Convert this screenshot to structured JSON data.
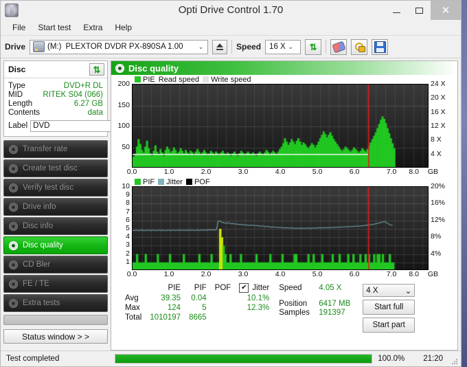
{
  "window": {
    "title": "Opti Drive Control 1.70",
    "app_icon": "disc-app-icon",
    "minimize": "–",
    "maximize": "□",
    "close": "✕"
  },
  "menu": {
    "items": [
      {
        "label": "File"
      },
      {
        "label": "Start test"
      },
      {
        "label": "Extra"
      },
      {
        "label": "Help"
      }
    ]
  },
  "toolbar": {
    "drive_label": "Drive",
    "drive_letter": "(M:)",
    "drive_name": "PLEXTOR DVDR   PX-890SA 1.00",
    "combo_arrow": "⌄",
    "eject_title": "Eject",
    "speed_label": "Speed",
    "speed_value": "16 X",
    "speed_arrow": "⌄",
    "refresh_icon": "⇅",
    "icons": [
      "refresh-icon",
      "eraser-icon",
      "plug-icon",
      "save-icon"
    ]
  },
  "disc": {
    "title": "Disc",
    "refresh_icon": "⇅",
    "rows": [
      {
        "key": "Type",
        "value": "DVD+R DL"
      },
      {
        "key": "MID",
        "value": "RITEK S04 (066)"
      },
      {
        "key": "Length",
        "value": "6.27 GB"
      },
      {
        "key": "Contents",
        "value": "data"
      }
    ],
    "label_key": "Label",
    "label_value": "DVD",
    "label_placeholder": "DVD"
  },
  "nav": {
    "items": [
      {
        "label": "Transfer rate",
        "active": false
      },
      {
        "label": "Create test disc",
        "active": false
      },
      {
        "label": "Verify test disc",
        "active": false
      },
      {
        "label": "Drive info",
        "active": false
      },
      {
        "label": "Disc info",
        "active": false
      },
      {
        "label": "Disc quality",
        "active": true
      },
      {
        "label": "CD Bler",
        "active": false
      },
      {
        "label": "FE / TE",
        "active": false
      },
      {
        "label": "Extra tests",
        "active": false
      }
    ],
    "status_window_button": "Status window > >"
  },
  "panel": {
    "header_title": "Disc quality",
    "header_icon": "disc-quality-icon"
  },
  "chart_data": [
    {
      "type": "area",
      "name": "pie-chart",
      "title": "PIE / Read speed",
      "xlabel": "GB",
      "ylabel": "PIE",
      "legend": [
        {
          "label": "PIE",
          "color": "#22c722"
        },
        {
          "label": "Read speed",
          "color": "#ffffff"
        },
        {
          "label": "Write speed",
          "color": "#d8d8d8"
        }
      ],
      "legend_position": "top-left",
      "grid": true,
      "xlim": [
        0.0,
        8.0
      ],
      "xticks": [
        "0.0",
        "1.0",
        "2.0",
        "3.0",
        "4.0",
        "5.0",
        "6.0",
        "7.0",
        "8.0"
      ],
      "x_unit": "GB",
      "ylim": [
        0,
        200
      ],
      "yticks": [
        "200",
        "150",
        "100",
        "50"
      ],
      "y2label": "Speed",
      "y2lim": [
        0,
        24
      ],
      "y2ticks": [
        "24 X",
        "20 X",
        "16 X",
        "12 X",
        "8 X",
        "4 X"
      ],
      "data_end_gb": 6.3,
      "marker_gb": 6.3,
      "marker_color": "#e01b1b",
      "read_speed_value": 4.05,
      "series": [
        {
          "name": "PIE",
          "color": "#22c722",
          "values": [
            28,
            35,
            52,
            70,
            58,
            44,
            38,
            52,
            66,
            48,
            36,
            30,
            42,
            55,
            40,
            34,
            46,
            38,
            30,
            44,
            52,
            46,
            38,
            42,
            50,
            44,
            36,
            40,
            48,
            42,
            36,
            44,
            38,
            34,
            42,
            38,
            32,
            40,
            46,
            40,
            34,
            38,
            44,
            38,
            32,
            36,
            42,
            38,
            34,
            40,
            36,
            32,
            38,
            42,
            36,
            32,
            38,
            34,
            30,
            36,
            40,
            34,
            30,
            36,
            42,
            38,
            32,
            36,
            40,
            36,
            32,
            38,
            34,
            30,
            36,
            40,
            36,
            32,
            38,
            44,
            40,
            34,
            38,
            42,
            38,
            34,
            40,
            46,
            52,
            60,
            72,
            64,
            56,
            62,
            70,
            64,
            58,
            66,
            72,
            64,
            56,
            62,
            58,
            52,
            48,
            54,
            60,
            56,
            50,
            56,
            64,
            72,
            80,
            88,
            82,
            74,
            80,
            86,
            78,
            70,
            64,
            58,
            52,
            46,
            42,
            46,
            52,
            48,
            44,
            40,
            44,
            50,
            46,
            42,
            38,
            42,
            48,
            44,
            40,
            46,
            54,
            62,
            70,
            78,
            86,
            96,
            106,
            116,
            124,
            118,
            108,
            96,
            84,
            72,
            60,
            48,
            0,
            0,
            0,
            0,
            0,
            0,
            0,
            0,
            0,
            0,
            0,
            0,
            0,
            0,
            0,
            0,
            0,
            0,
            0,
            0,
            0,
            0
          ]
        },
        {
          "name": "Read speed",
          "color": "#ffffff",
          "values_x": [
            4.05,
            4.05
          ]
        }
      ]
    },
    {
      "type": "bar",
      "name": "pif-chart",
      "title": "PIF / Jitter / POF",
      "xlabel": "GB",
      "ylabel": "PIF",
      "legend": [
        {
          "label": "PIF",
          "color": "#22c722"
        },
        {
          "label": "Jitter",
          "color": "#7fb3bd"
        },
        {
          "label": "POF",
          "color": "#000000"
        }
      ],
      "legend_position": "top-left",
      "grid": true,
      "xlim": [
        0.0,
        8.0
      ],
      "xticks": [
        "0.0",
        "1.0",
        "2.0",
        "3.0",
        "4.0",
        "5.0",
        "6.0",
        "7.0",
        "8.0"
      ],
      "x_unit": "GB",
      "ylim": [
        0,
        10
      ],
      "yticks": [
        "10",
        "9",
        "8",
        "7",
        "6",
        "5",
        "4",
        "3",
        "2",
        "1"
      ],
      "y2label": "Jitter",
      "y2lim": [
        0,
        20
      ],
      "y2ticks": [
        "20%",
        "16%",
        "12%",
        "8%",
        "4%"
      ],
      "data_end_gb": 6.3,
      "marker_gb": 6.3,
      "marker_color": "#e01b1b",
      "series": [
        {
          "name": "PIF",
          "color": "#22c722",
          "values": [
            1,
            1,
            2,
            1,
            1,
            1,
            1,
            2,
            1,
            1,
            1,
            1,
            1,
            1,
            2,
            1,
            1,
            1,
            1,
            1,
            1,
            2,
            1,
            1,
            1,
            1,
            1,
            1,
            1,
            2,
            1,
            1,
            1,
            1,
            1,
            1,
            1,
            1,
            2,
            1,
            1,
            1,
            1,
            1,
            1,
            2,
            1,
            1,
            1,
            1,
            5,
            4,
            3,
            2,
            1,
            1,
            2,
            1,
            1,
            1,
            1,
            1,
            2,
            1,
            1,
            1,
            1,
            1,
            1,
            1,
            1,
            2,
            1,
            1,
            1,
            1,
            1,
            1,
            1,
            2,
            1,
            1,
            1,
            1,
            1,
            1,
            2,
            1,
            1,
            1,
            1,
            1,
            1,
            2,
            2,
            1,
            1,
            1,
            1,
            1,
            1,
            2,
            1,
            1,
            2,
            1,
            1,
            1,
            1,
            2,
            1,
            1,
            1,
            1,
            1,
            2,
            1,
            1,
            1,
            2,
            1,
            1,
            1,
            1,
            2,
            1,
            1,
            2,
            1,
            1,
            1,
            2,
            1,
            1,
            2,
            1,
            2,
            1,
            1,
            2,
            1,
            2,
            2,
            1,
            2,
            1,
            1,
            1,
            2,
            1,
            1,
            0,
            0,
            0,
            0,
            0,
            0,
            0,
            0,
            0,
            0,
            0,
            0,
            0,
            0,
            0,
            0,
            0,
            0,
            0,
            0,
            0,
            0
          ]
        },
        {
          "name": "Jitter",
          "color": "#7fb3bd",
          "values": [
            9.6,
            9.6,
            9.7,
            9.6,
            9.6,
            9.7,
            9.6,
            9.6,
            9.6,
            9.7,
            9.6,
            9.6,
            9.7,
            9.6,
            9.6,
            9.7,
            9.6,
            9.6,
            9.7,
            9.6,
            9.6,
            9.7,
            9.6,
            9.6,
            9.7,
            9.6,
            9.7,
            9.6,
            9.7,
            9.6,
            9.7,
            9.6,
            9.7,
            9.6,
            9.7,
            9.7,
            9.6,
            9.7,
            9.7,
            9.6,
            9.7,
            9.7,
            9.7,
            9.7,
            9.7,
            9.8,
            9.7,
            9.8,
            9.7,
            9.8,
            11.8,
            11.9,
            11.6,
            11.5,
            11.4,
            11.3,
            11.5,
            11.3,
            11.2,
            11.3,
            11.1,
            11.2,
            11.0,
            11.1,
            11.0,
            10.9,
            11.0,
            10.9,
            10.8,
            10.9,
            10.8,
            10.9,
            10.7,
            10.8,
            10.7,
            10.6,
            10.7,
            10.6,
            10.5,
            10.6,
            10.5,
            10.4,
            10.5,
            10.4,
            10.4,
            10.3,
            10.4,
            10.3,
            10.3,
            10.2,
            10.3,
            10.2,
            10.2,
            10.2,
            10.2,
            10.1,
            10.2,
            10.1,
            10.2,
            10.1,
            10.2,
            10.1,
            10.2,
            10.2,
            10.1,
            10.2,
            10.2,
            10.2,
            10.2,
            10.3,
            10.2,
            10.3,
            10.2,
            10.3,
            10.3,
            10.3,
            10.3,
            10.4,
            10.3,
            10.4,
            10.4,
            10.4,
            10.5,
            10.4,
            10.5,
            10.5,
            10.5,
            10.6,
            10.5,
            10.6,
            10.6,
            10.7,
            10.6,
            10.7,
            10.7,
            10.8,
            10.8,
            10.9,
            10.9,
            11.0,
            11.0,
            11.1,
            11.2,
            11.3,
            11.4,
            11.5,
            11.6,
            11.7,
            11.6,
            11.3,
            11.1,
            10.9,
            10.8,
            0,
            0,
            0,
            0,
            0,
            0,
            0,
            0,
            0,
            0,
            0,
            0,
            0,
            0,
            0,
            0,
            0,
            0,
            0,
            0,
            0,
            0
          ]
        }
      ]
    }
  ],
  "stats": {
    "columns": [
      "PIE",
      "PIF",
      "POF",
      "Jitter"
    ],
    "jitter_checked": true,
    "jitter_check_glyph": "✔",
    "rows": [
      {
        "label": "Avg",
        "pie": "39.35",
        "pif": "0.04",
        "pof": "",
        "jitter": "10.1%"
      },
      {
        "label": "Max",
        "pie": "124",
        "pif": "5",
        "pof": "",
        "jitter": "12.3%"
      },
      {
        "label": "Total",
        "pie": "1010197",
        "pif": "8665",
        "pof": "",
        "jitter": ""
      }
    ]
  },
  "controls": {
    "speed_key": "Speed",
    "speed_value": "4.05 X",
    "position_key": "Position",
    "position_value": "6417 MB",
    "samples_key": "Samples",
    "samples_value": "191397",
    "speed_select_value": "4 X",
    "speed_select_arrow": "⌄",
    "start_full": "Start full",
    "start_part": "Start part"
  },
  "statusbar": {
    "text": "Test completed",
    "progress_percent": "100.0%",
    "progress_value": 100,
    "time": "21:20"
  }
}
